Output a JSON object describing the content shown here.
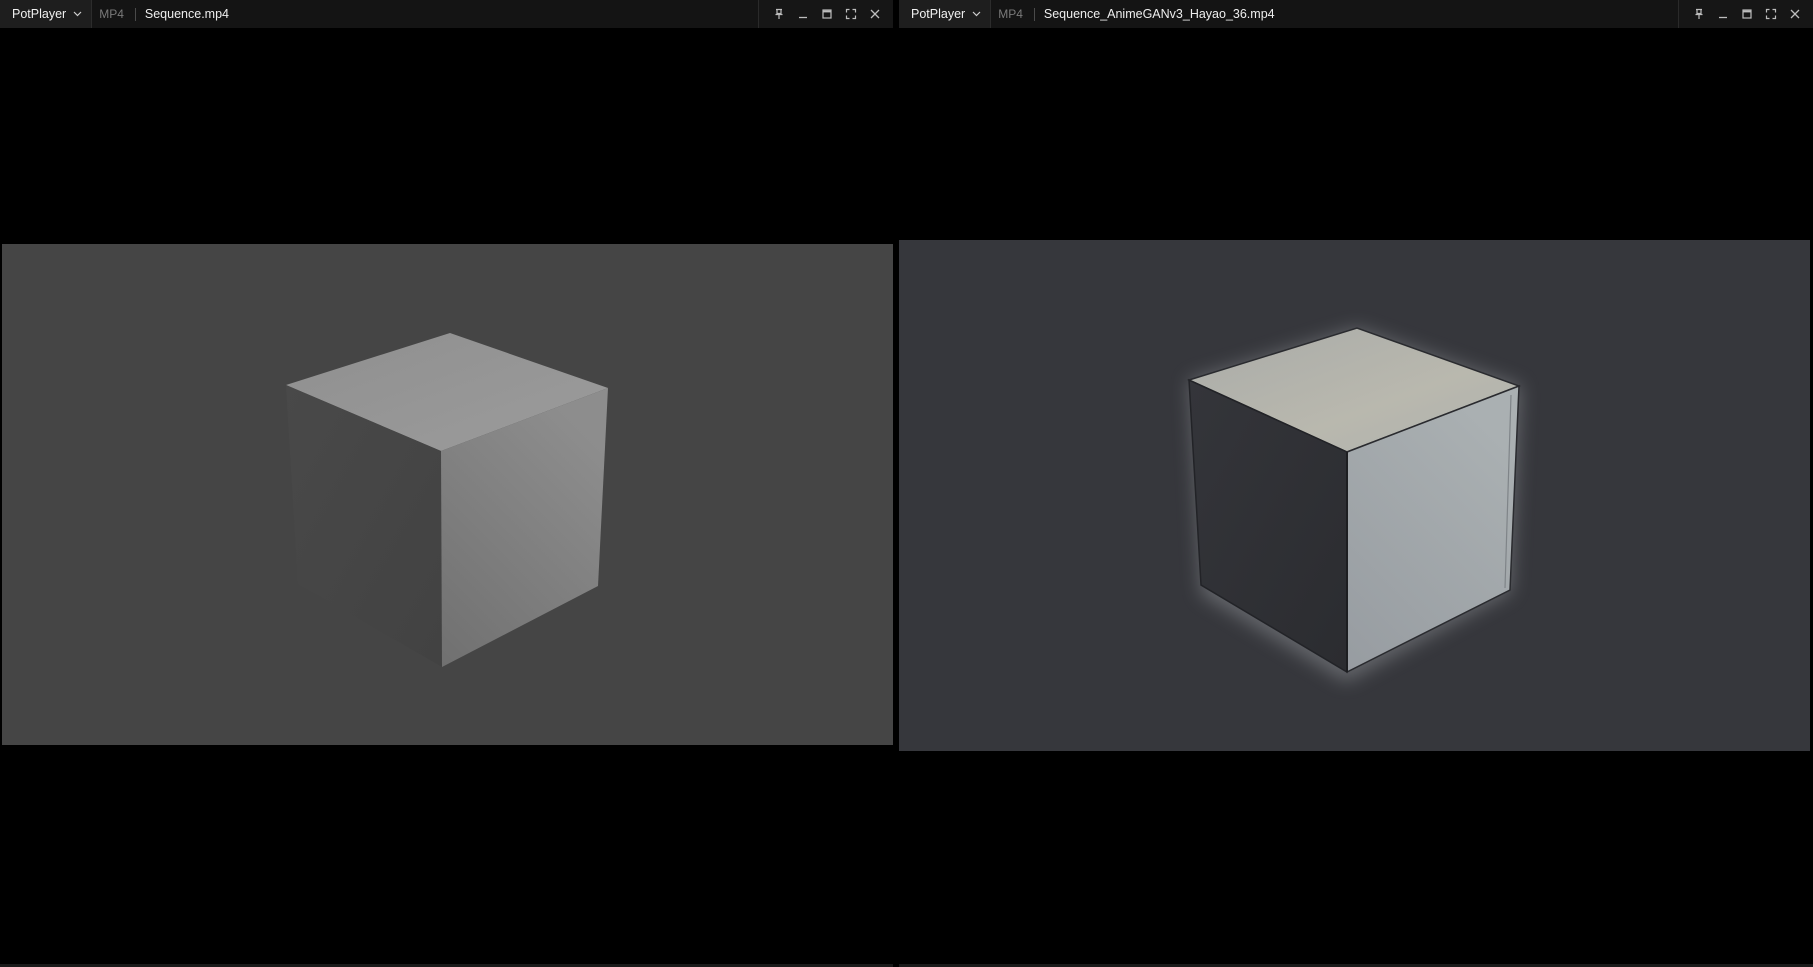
{
  "players": [
    {
      "app_menu_label": "PotPlayer",
      "format_tag": "MP4",
      "filename": "Sequence.mp4"
    },
    {
      "app_menu_label": "PotPlayer",
      "format_tag": "MP4",
      "filename": "Sequence_AnimeGANv3_Hayao_36.mp4"
    }
  ],
  "colors": {
    "titlebar_bg": "#141414",
    "left_video_bg": "#454545",
    "right_video_bg": "#36373c",
    "left_cube_top": "#939393",
    "left_cube_left": "#464646",
    "left_cube_right": "#7d7d7d",
    "right_cube_top": "#b1b3ae",
    "right_cube_left": "#2e2f33",
    "right_cube_right": "#a2a7ab"
  },
  "icons": [
    "chevron-down-icon",
    "pin-icon",
    "minimize-icon",
    "maximize-icon",
    "fullscreen-icon",
    "close-icon"
  ]
}
